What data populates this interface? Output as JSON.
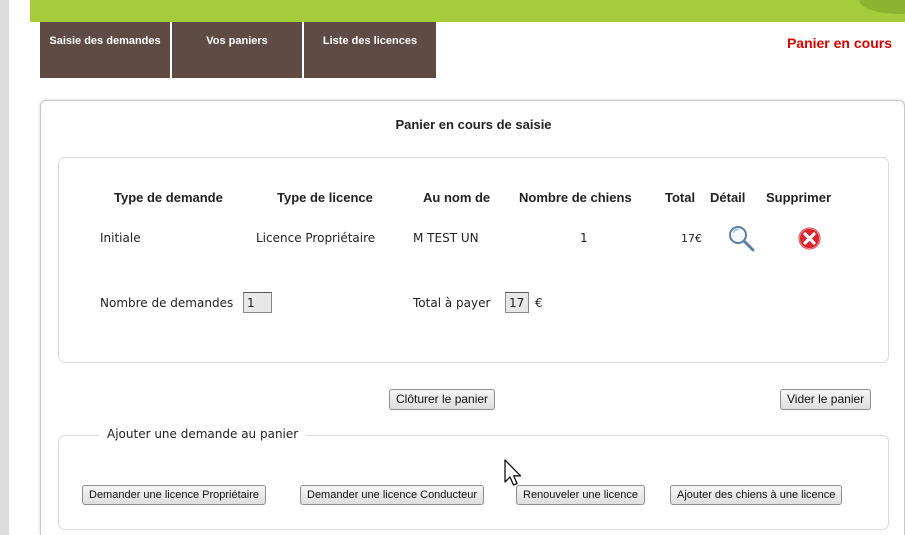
{
  "nav": {
    "tabs": [
      {
        "label": "Saisie des demandes"
      },
      {
        "label": "Vos paniers"
      },
      {
        "label": "Liste des licences"
      }
    ],
    "current_cart_label": "Panier en cours"
  },
  "panel": {
    "title": "Panier en cours de saisie"
  },
  "cart": {
    "columns": {
      "request_type": "Type de demande",
      "license_type": "Type de licence",
      "name": "Au nom de",
      "dog_count": "Nombre de chiens",
      "total": "Total",
      "detail": "Détail",
      "delete": "Supprimer"
    },
    "rows": [
      {
        "request_type": "Initiale",
        "license_type": "Licence Propriétaire",
        "name": "M TEST UN",
        "dog_count": "1",
        "total": "17€",
        "detail_icon": "search-icon",
        "delete_icon": "delete-icon"
      }
    ],
    "summary": {
      "request_count_label": "Nombre de demandes",
      "request_count_value": "1",
      "total_label": "Total à payer",
      "total_value": "17",
      "currency": "€"
    }
  },
  "actions": {
    "close_cart": "Clôturer le panier",
    "empty_cart": "Vider le panier"
  },
  "add_request": {
    "legend": "Ajouter une demande au panier",
    "buttons": {
      "owner_license": "Demander une licence Propriétaire",
      "driver_license": "Demander une licence Conducteur",
      "renew_license": "Renouveler une licence",
      "add_dogs": "Ajouter des chiens à une licence"
    }
  },
  "colors": {
    "accent_green": "#a6cc3e",
    "tab_brown": "#5e4b43",
    "alert_red": "#d40000",
    "delete_red": "#d8262f"
  }
}
